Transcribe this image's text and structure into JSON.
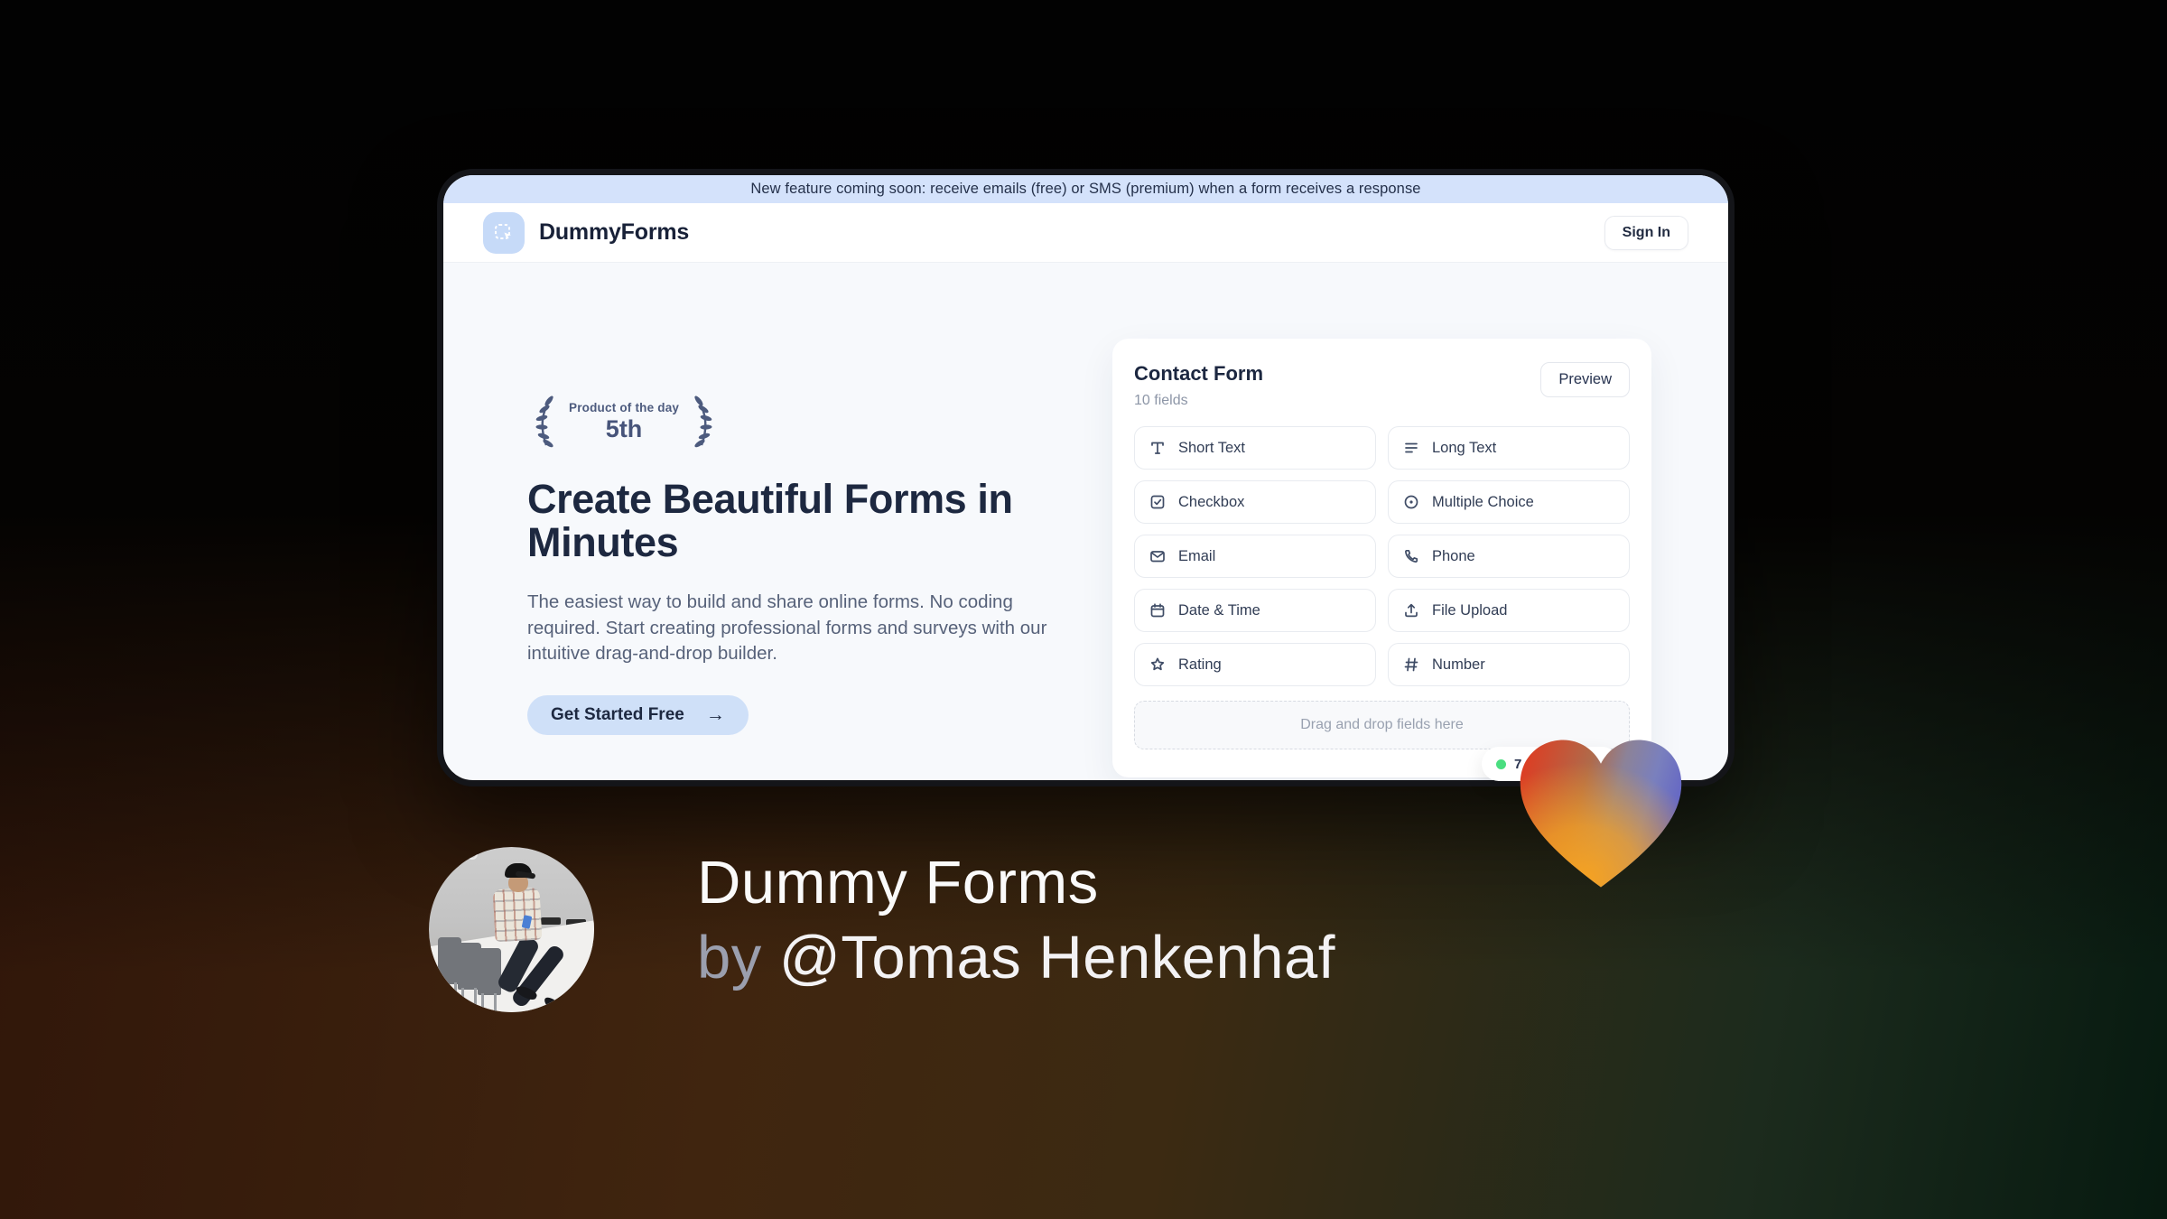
{
  "banner": {
    "text": "New feature coming soon: receive emails (free) or SMS (premium) when a form receives a response",
    "bg_color": "#d4e2fb"
  },
  "header": {
    "brand": "DummyForms",
    "logo_icon": "cursor-dashed-square-icon",
    "sign_in_label": "Sign In"
  },
  "hero": {
    "award": {
      "line1": "Product of the day",
      "line2": "5th"
    },
    "title": "Create Beautiful Forms in Minutes",
    "description": "The easiest way to build and share online forms. No coding required. Start creating professional forms and surveys with our intuitive drag-and-drop builder.",
    "cta_label": "Get Started Free",
    "cta_arrow": "→",
    "cta_bg_color": "#cfe0f8"
  },
  "form_builder": {
    "title": "Contact Form",
    "subtitle": "10 fields",
    "preview_label": "Preview",
    "fields": [
      {
        "label": "Short Text",
        "icon": "text-icon"
      },
      {
        "label": "Long Text",
        "icon": "lines-icon"
      },
      {
        "label": "Checkbox",
        "icon": "checkbox-icon"
      },
      {
        "label": "Multiple Choice",
        "icon": "radio-icon"
      },
      {
        "label": "Email",
        "icon": "envelope-icon"
      },
      {
        "label": "Phone",
        "icon": "phone-icon"
      },
      {
        "label": "Date & Time",
        "icon": "calendar-icon"
      },
      {
        "label": "File Upload",
        "icon": "upload-icon"
      },
      {
        "label": "Rating",
        "icon": "star-icon"
      },
      {
        "label": "Number",
        "icon": "hash-icon"
      }
    ],
    "dropzone_text": "Drag and drop fields here",
    "status_badge": {
      "visible_text": "7",
      "dot_color": "#4ade80"
    }
  },
  "footer": {
    "product_name": "Dummy Forms",
    "by_prefix": "by ",
    "author_handle": "@Tomas Henkenhaf"
  },
  "colors": {
    "window_bg": "#f7f9fc",
    "heading": "#1d2840",
    "muted_text": "#57627a",
    "heart_red": "#e03a20",
    "heart_orange": "#f6a221",
    "heart_blue": "#6668c4"
  }
}
